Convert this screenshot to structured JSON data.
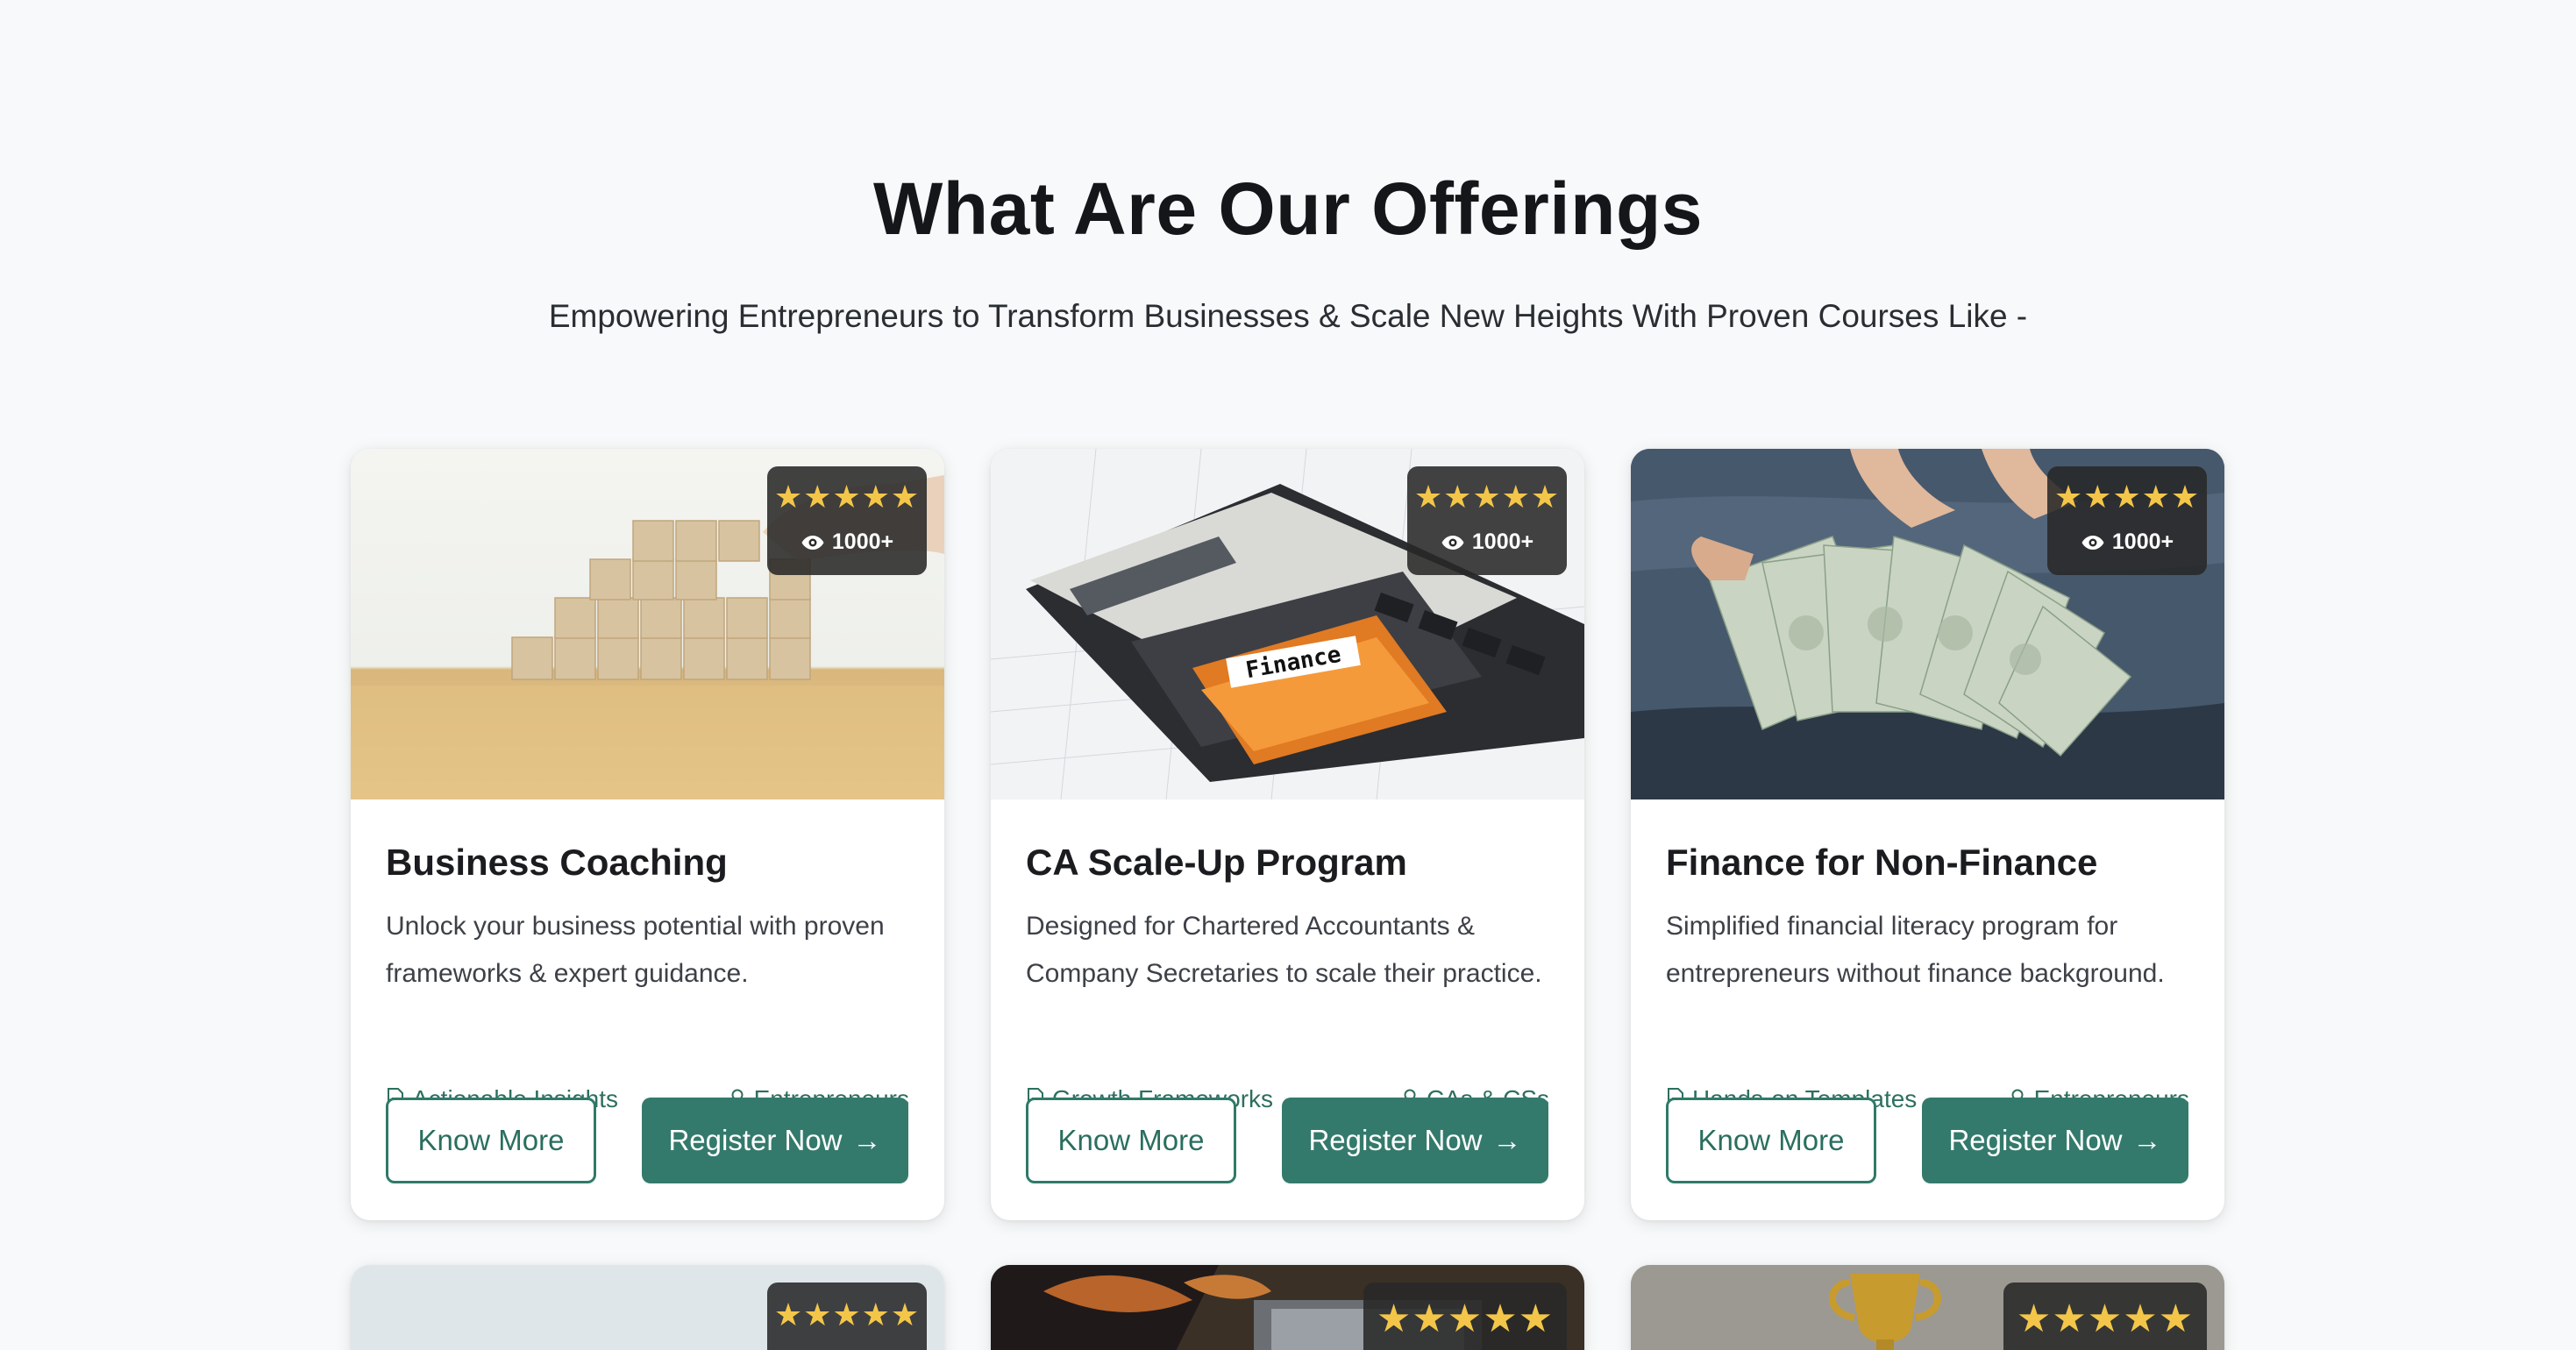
{
  "section": {
    "title": "What Are Our Offerings",
    "subtitle": "Empowering Entrepreneurs to Transform Businesses & Scale New Heights With Proven Courses Like -"
  },
  "cards": [
    {
      "title": "Business Coaching",
      "description": "Unlock your business potential with proven frameworks & expert guidance.",
      "rating_stars": "★★★★★",
      "views": "1000+",
      "tag_left": "Actionable Insights",
      "tag_right": "Entrepreneurs",
      "know_more_label": "Know More",
      "register_label": "Register Now",
      "register_arrow": "→"
    },
    {
      "title": "CA Scale-Up Program",
      "description": "Designed for Chartered Accountants & Company Secretaries to scale their practice.",
      "rating_stars": "★★★★★",
      "views": "1000+",
      "tag_left": "Growth Frameworks",
      "tag_right": "CAs & CSs",
      "know_more_label": "Know More",
      "register_label": "Register Now",
      "register_arrow": "→",
      "image_text": "Finance"
    },
    {
      "title": "Finance for Non-Finance",
      "description": "Simplified financial literacy program for entrepreneurs without finance background.",
      "rating_stars": "★★★★★",
      "views": "1000+",
      "tag_left": "Hands-on Templates",
      "tag_right": "Entrepreneurs",
      "know_more_label": "Know More",
      "register_label": "Register Now",
      "register_arrow": "→"
    }
  ],
  "row2_cards": [
    {
      "rating_stars": "★★★★★"
    },
    {
      "rating_stars": "★★★★★"
    },
    {
      "rating_stars": "★★★★★"
    }
  ],
  "colors": {
    "accent": "#347a6c",
    "accent_text": "#2e6f5f",
    "stars": "#f3c64a",
    "background": "#f7f9fa"
  },
  "icons": {
    "views": "eye-icon",
    "tag_left": "document-icon",
    "tag_right": "user-icon"
  }
}
